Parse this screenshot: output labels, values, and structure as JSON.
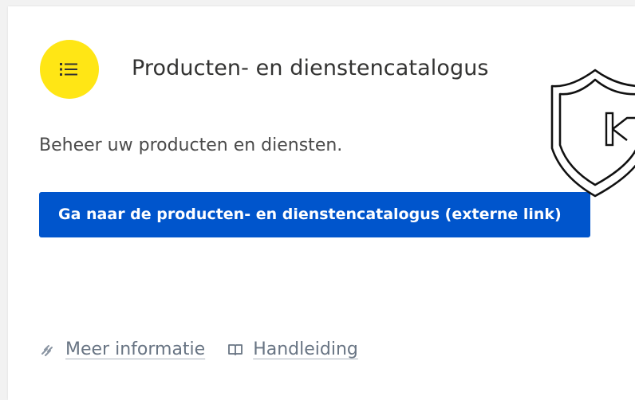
{
  "card": {
    "icon": "list-icon",
    "title": "Producten- en dienstencatalogus",
    "description": "Beheer uw producten en diensten.",
    "cta_label": "Ga naar de producten- en dienstencatalogus (externe link)"
  },
  "footer": {
    "links": [
      {
        "icon": "link-icon",
        "label": "Meer informatie"
      },
      {
        "icon": "book-icon",
        "label": "Handleiding"
      }
    ]
  },
  "overlay": {
    "icon": "shield-icon"
  },
  "colors": {
    "accent_yellow": "#ffe615",
    "button_blue": "#0055cc",
    "link_grey": "#687483"
  }
}
